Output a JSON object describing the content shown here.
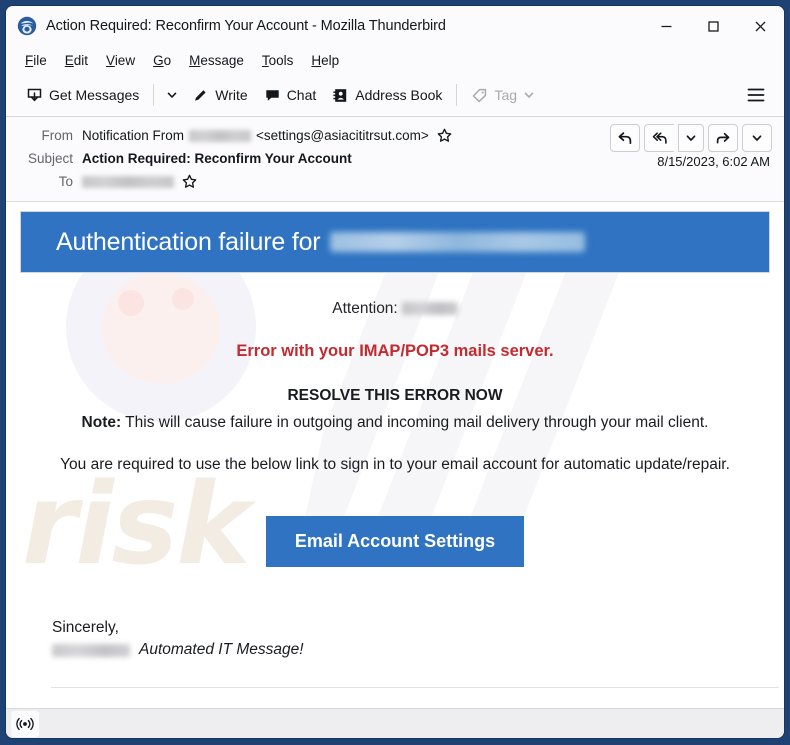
{
  "window": {
    "title": "Action Required: Reconfirm Your Account - Mozilla Thunderbird",
    "app_icon": "thunderbird-icon",
    "controls": {
      "minimize": "minimize-icon",
      "maximize": "maximize-icon",
      "close": "close-icon"
    }
  },
  "menubar": {
    "items": [
      {
        "label": "File",
        "accel": "F"
      },
      {
        "label": "Edit",
        "accel": "E"
      },
      {
        "label": "View",
        "accel": "V"
      },
      {
        "label": "Go",
        "accel": "G"
      },
      {
        "label": "Message",
        "accel": "M"
      },
      {
        "label": "Tools",
        "accel": "T"
      },
      {
        "label": "Help",
        "accel": "H"
      }
    ]
  },
  "toolbar": {
    "get_messages_label": "Get Messages",
    "write_label": "Write",
    "chat_label": "Chat",
    "address_book_label": "Address Book",
    "tag_label": "Tag",
    "tag_disabled": true,
    "hamburger": "app-menu-icon"
  },
  "message_header": {
    "from_label": "From",
    "from_name": "Notification From",
    "from_address": "<settings@asiacititrsut.com>",
    "subject_label": "Subject",
    "subject_value": "Action Required: Reconfirm Your Account",
    "to_label": "To",
    "date": "8/15/2023, 6:02 AM",
    "actions": [
      {
        "name": "reply-button",
        "icon": "reply-icon"
      },
      {
        "name": "reply-all-button",
        "icon": "reply-all-icon"
      },
      {
        "name": "reply-all-dropdown",
        "icon": "chevron-down-icon"
      },
      {
        "name": "forward-button",
        "icon": "forward-icon"
      },
      {
        "name": "more-actions-dropdown",
        "icon": "chevron-down-icon"
      }
    ]
  },
  "email": {
    "banner_title": "Authentication failure for",
    "attention_label": "Attention:",
    "error_text": "Error with your IMAP/POP3 mails server.",
    "resolve_text": "RESOLVE THIS ERROR NOW",
    "note_bold": "Note:",
    "note_text": " This will cause failure in outgoing and incoming mail delivery through your mail client.",
    "required_text": "You are required to use the below link to sign in to your email account for automatic update/repair.",
    "cta_label": "Email Account Settings",
    "sincerely_text": "Sincerely,",
    "signature_text": "Automated IT Message!",
    "watermark_text": "risk"
  },
  "statusbar": {
    "icon": "network-activity-icon"
  },
  "colors": {
    "banner_blue": "#2f73c2",
    "cta_blue": "#2f73c2",
    "error_red": "#c42b30",
    "window_frame": "#1f4274",
    "toolbar_bg": "#fbfbfd"
  }
}
